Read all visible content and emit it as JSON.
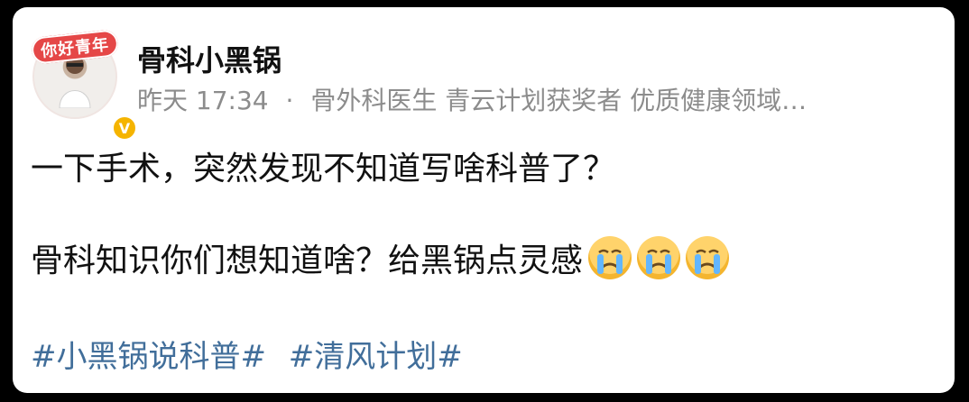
{
  "post": {
    "author": {
      "name": "骨科小黑锅",
      "avatar_badge": "你好青年",
      "verified_icon": "V"
    },
    "meta": {
      "time": "昨天 17:34",
      "separator": "·",
      "bio": "骨外科医生 青云计划获奖者 优质健康领域…"
    },
    "content": {
      "line1": "一下手术，突然发现不知道写啥科普了？",
      "line2": "骨科知识你们想知道啥？给黑锅点灵感",
      "emojis": [
        "crying-face",
        "crying-face",
        "crying-face"
      ]
    },
    "tags": [
      "#小黑锅说科普#",
      "#清风计划#"
    ]
  },
  "colors": {
    "tag": "#416e9a",
    "meta": "#8c8c8c",
    "badge": "#e54747",
    "verified": "#f5b400"
  }
}
